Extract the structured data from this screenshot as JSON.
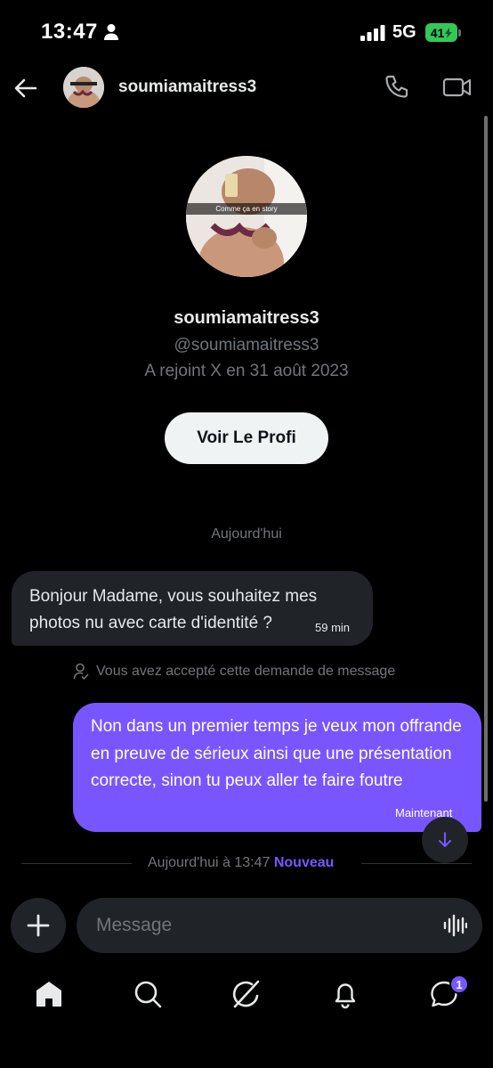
{
  "status_bar": {
    "time": "13:47",
    "network": "5G",
    "battery": "41"
  },
  "header": {
    "username": "soumiamaitress3"
  },
  "profile": {
    "story_caption": "Comme ça en story",
    "name": "soumiamaitress3",
    "handle": "@soumiamaitress3",
    "joined": "A rejoint X en 31 août 2023",
    "view_profile_label": "Voir Le Profi"
  },
  "conversation": {
    "date_divider": "Aujourd'hui",
    "incoming": {
      "text": "Bonjour Madame, vous souhaitez mes photos nu avec carte d'identité ?",
      "time": "59 min"
    },
    "accepted_notice": "Vous avez accepté cette demande de message",
    "outgoing": {
      "text": "Non dans un premier temps je veux mon offrande en preuve de sérieux ainsi que une présentation correcte, sinon tu peux aller te faire foutre",
      "time": "Maintenant"
    },
    "new_divider": {
      "label": "Aujourd'hui à 13:47",
      "badge": "Nouveau"
    }
  },
  "composer": {
    "placeholder": "Message"
  },
  "bottom_nav": {
    "messages_badge": "1"
  },
  "colors": {
    "accent": "#7856ff",
    "background": "#000000",
    "bubble_incoming": "#202327",
    "muted_text": "#71767b",
    "battery": "#34c759"
  },
  "icons": [
    "person-icon",
    "signal-icon",
    "back-arrow-icon",
    "phone-icon",
    "video-icon",
    "user-check-icon",
    "arrow-down-icon",
    "plus-icon",
    "voice-wave-icon",
    "home-icon",
    "search-icon",
    "grok-icon",
    "bell-icon",
    "messages-icon"
  ]
}
